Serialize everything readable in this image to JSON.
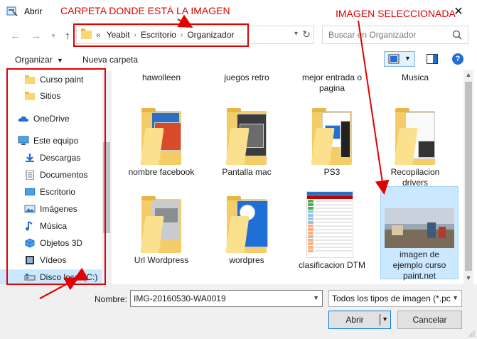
{
  "window": {
    "title": "Abrir"
  },
  "address_bar": {
    "overflow": "«",
    "crumbs": [
      "Yeabit",
      "Escritorio",
      "Organizador"
    ]
  },
  "search": {
    "placeholder": "Buscar en Organizador"
  },
  "toolbar": {
    "organize_label": "Organizar",
    "new_folder_label": "Nueva carpeta"
  },
  "nav_pane": {
    "items": [
      {
        "label": "Curso paint",
        "icon": "folder-icon"
      },
      {
        "label": "Sitios",
        "icon": "folder-icon"
      },
      {
        "label": "OneDrive",
        "icon": "cloud-icon"
      },
      {
        "label": "Este equipo",
        "icon": "computer-icon"
      },
      {
        "label": "Descargas",
        "icon": "download-icon"
      },
      {
        "label": "Documentos",
        "icon": "documents-icon"
      },
      {
        "label": "Escritorio",
        "icon": "desktop-icon"
      },
      {
        "label": "Imágenes",
        "icon": "pictures-icon"
      },
      {
        "label": "Música",
        "icon": "music-icon"
      },
      {
        "label": "Objetos 3D",
        "icon": "objects-3d-icon"
      },
      {
        "label": "Vídeos",
        "icon": "videos-icon"
      },
      {
        "label": "Disco local (C:)",
        "icon": "drive-icon"
      }
    ]
  },
  "files": {
    "row1": [
      "hawolleen",
      "juegos retro",
      "mejor entrada o pagina",
      "Musica"
    ],
    "row2": [
      "nombre facebook",
      "Pantalla mac",
      "PS3",
      "Recopilacion drivers"
    ],
    "row3": [
      "Url Wordpress",
      "wordpres",
      "clasificacion DTM",
      "imagen de ejemplo curso paint.net"
    ]
  },
  "bottom": {
    "name_label": "Nombre:",
    "name_value": "IMG-20160530-WA0019",
    "type_value": "Todos los tipos de imagen (*.pc",
    "open_label": "Abrir",
    "cancel_label": "Cancelar"
  },
  "annotations": {
    "folder_note": "CARPETA DONDE ESTÁ LA IMAGEN",
    "selected_note": "IMAGEN SELECCIONADA"
  },
  "colors": {
    "accent": "#0078d7",
    "annotation": "#e00000",
    "selection": "#cce8ff",
    "folder": "#f8d775"
  }
}
